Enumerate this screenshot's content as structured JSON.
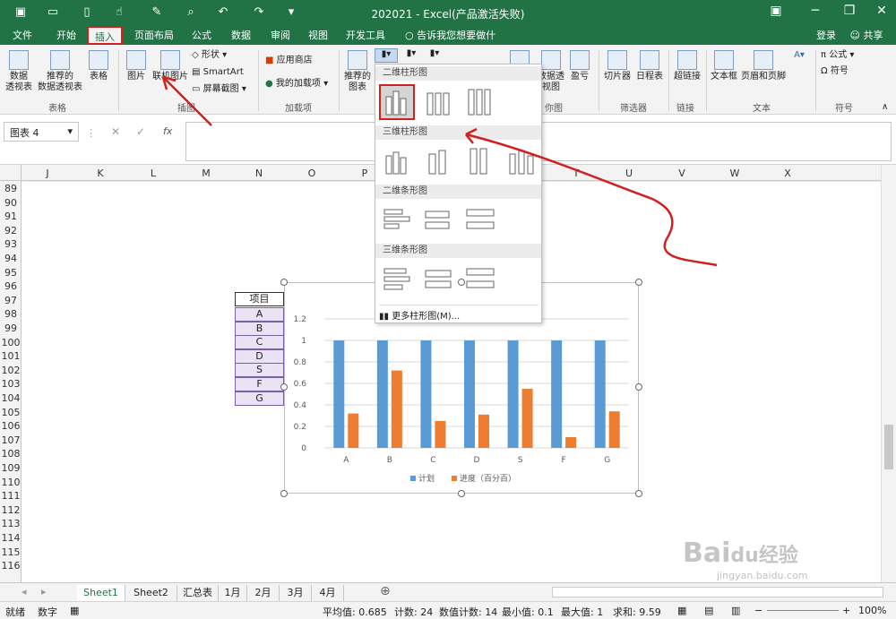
{
  "window": {
    "title": "202021 - Excel(产品激活失败)"
  },
  "ribbon_tabs": [
    "文件",
    "开始",
    "插入",
    "页面布局",
    "公式",
    "数据",
    "审阅",
    "视图",
    "开发工具"
  ],
  "tell_me": "告诉我您想要做什么...",
  "account": {
    "login": "登录",
    "share": "共享"
  },
  "ribbon": {
    "pivot": "数据\n透视表",
    "recommended_pivot": "推荐的\n数据透视表",
    "table": "表格",
    "group_tables": "表格",
    "picture": "图片",
    "online_picture": "联机图片",
    "shapes": "形状",
    "smartart": "SmartArt",
    "screenshot": "屏幕截图",
    "group_illustrations": "插图",
    "store": "应用商店",
    "my_addins": "我的加载项",
    "group_addins": "加载项",
    "recommended_charts": "推荐的\n图表",
    "pivotchart": "数据透视图",
    "winloss": "盈亏",
    "group_sparklines_partial": "你图",
    "slicer": "切片器",
    "timeline": "日程表",
    "group_filters": "筛选器",
    "hyperlink": "超链接",
    "group_links": "链接",
    "textbox": "文本框",
    "header_footer": "页眉和页脚",
    "group_text": "文本",
    "equation": "公式",
    "symbol": "符号",
    "group_symbols": "符号"
  },
  "namebox": "图表 4",
  "columns": [
    "J",
    "K",
    "L",
    "M",
    "N",
    "O",
    "P",
    "Q",
    "R",
    "S",
    "T",
    "U",
    "V",
    "W",
    "X"
  ],
  "rows": [
    "89",
    "90",
    "91",
    "92",
    "93",
    "94",
    "95",
    "96",
    "97",
    "98",
    "99",
    "100",
    "101",
    "102",
    "103",
    "104",
    "105",
    "106",
    "107",
    "108",
    "109",
    "110",
    "111",
    "112",
    "113",
    "114",
    "115",
    "116"
  ],
  "table": {
    "header": "项目",
    "items": [
      "A",
      "B",
      "C",
      "D",
      "S",
      "F",
      "G"
    ]
  },
  "dropdown": {
    "h1": "二维柱形图",
    "h2": "三维柱形图",
    "h3": "二维条形图",
    "h4": "三维条形图",
    "more": "更多柱形图(M)..."
  },
  "chart_data": {
    "type": "bar",
    "categories": [
      "A",
      "B",
      "C",
      "D",
      "S",
      "F",
      "G"
    ],
    "series": [
      {
        "name": "计划",
        "values": [
          1,
          1,
          1,
          1,
          1,
          1,
          1
        ],
        "color": "#5b9bd5"
      },
      {
        "name": "进度（百分百）",
        "values": [
          0.32,
          0.72,
          0.25,
          0.31,
          0.55,
          0.1,
          0.34
        ],
        "color": "#ed7d31"
      }
    ],
    "yticks": [
      "0",
      "0.2",
      "0.4",
      "0.6",
      "0.8",
      "1",
      "1.2"
    ],
    "ylim": [
      0,
      1.2
    ],
    "grid": true,
    "legend": "bottom"
  },
  "sheets": [
    "Sheet1",
    "Sheet2",
    "汇总表",
    "1月",
    "2月",
    "3月",
    "4月"
  ],
  "status": {
    "ready": "就绪",
    "mode": "数字",
    "avg": "平均值: 0.685",
    "count": "计数: 24",
    "numcount": "数值计数: 14",
    "min": "最小值: 0.1",
    "max": "最大值: 1",
    "sum": "求和: 9.59",
    "zoom": "100%"
  },
  "watermark": "Baidu经验 jingyan.baidu.com"
}
